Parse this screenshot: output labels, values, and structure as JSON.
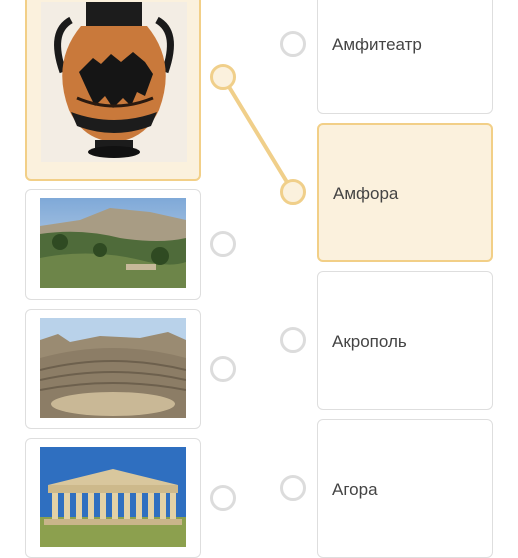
{
  "images": [
    {
      "name": "amphora",
      "icon": "amphora-image"
    },
    {
      "name": "agora",
      "icon": "agora-image"
    },
    {
      "name": "amphitheater",
      "icon": "amphitheater-image"
    },
    {
      "name": "acropolis-parthenon",
      "icon": "parthenon-image"
    }
  ],
  "answers": [
    {
      "label": "Амфитеатр"
    },
    {
      "label": "Амфора"
    },
    {
      "label": "Акрополь"
    },
    {
      "label": "Агора"
    }
  ],
  "colors": {
    "accent": "#f0cf8a",
    "selected_bg": "#fbf1dd",
    "border": "#dedede",
    "text": "#444444"
  }
}
